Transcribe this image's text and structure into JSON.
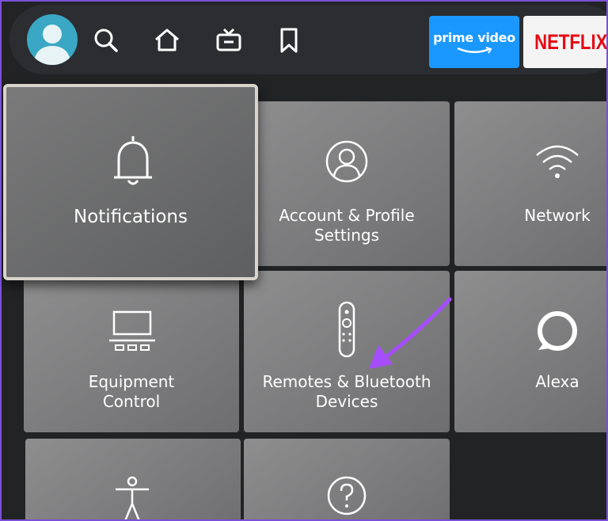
{
  "nav": {
    "icons": [
      "profile-avatar",
      "search-icon",
      "home-icon",
      "live-tv-icon",
      "bookmark-icon"
    ],
    "apps": {
      "prime_label": "prime video",
      "netflix_label": "NETFLIX"
    }
  },
  "settings": {
    "tiles": [
      {
        "label": "Notifications",
        "icon": "bell-icon",
        "focused": true
      },
      {
        "label": "Account & Profile\nSettings",
        "icon": "account-icon"
      },
      {
        "label": "Network",
        "icon": "wifi-icon"
      },
      {
        "label": "Equipment\nControl",
        "icon": "tv-equipment-icon"
      },
      {
        "label": "Remotes & Bluetooth\nDevices",
        "icon": "remote-icon"
      },
      {
        "label": "Alexa",
        "icon": "alexa-icon"
      },
      {
        "label": "",
        "icon": "accessibility-icon"
      },
      {
        "label": "",
        "icon": "help-icon"
      }
    ]
  },
  "annotation": {
    "color": "#a64dff",
    "points_to": "Remotes & Bluetooth Devices"
  }
}
